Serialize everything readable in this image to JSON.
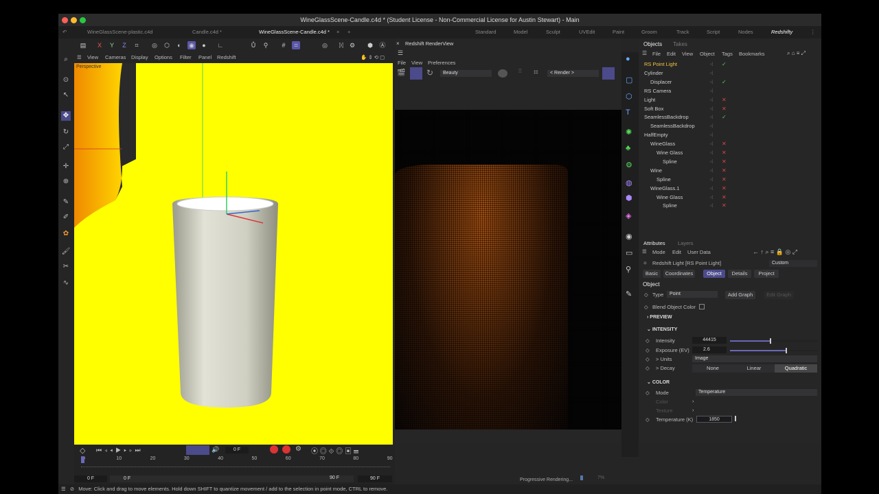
{
  "window": {
    "title": "WineGlassScene-Candle.c4d * (Student License - Non-Commercial License for Austin Stewart) - Main"
  },
  "doc_tabs": [
    "WineGlassScene-plastic.c4d",
    "Candle.c4d *",
    "WineGlassScene-Candle.c4d *"
  ],
  "workspaces": [
    "Standard",
    "Model",
    "Sculpt",
    "UVEdit",
    "Paint",
    "Groom",
    "Track",
    "Script",
    "Nodes",
    "Redshifty"
  ],
  "viewport": {
    "menu": [
      "View",
      "Cameras",
      "Display",
      "Options",
      "Filter",
      "Panel",
      "Redshift"
    ],
    "label": "Perspective",
    "axes": [
      "X",
      "Y",
      "Z"
    ]
  },
  "renderview": {
    "title": "Redshift RenderView",
    "menu": [
      "File",
      "View",
      "Preferences"
    ],
    "aov": "Beauty",
    "camera": "< Render >",
    "progress_label": "Progressive Rendering...",
    "progress_pct": "7%",
    "progress_value": 0.07
  },
  "objects": {
    "tabs": [
      "Objects",
      "Takes"
    ],
    "menu": [
      "File",
      "Edit",
      "View",
      "Object",
      "Tags",
      "Bookmarks"
    ],
    "items": [
      {
        "name": "RS Point Light",
        "indent": 0,
        "status": "check",
        "highlight": true
      },
      {
        "name": "Cylinder",
        "indent": 0,
        "status": ""
      },
      {
        "name": "Displacer",
        "indent": 1,
        "status": "check"
      },
      {
        "name": "RS Camera",
        "indent": 0,
        "status": ""
      },
      {
        "name": "Light",
        "indent": 0,
        "status": "x"
      },
      {
        "name": "Soft Box",
        "indent": 0,
        "status": "x"
      },
      {
        "name": "SeamlessBackdrop",
        "indent": 0,
        "status": "check"
      },
      {
        "name": "SeamlessBackdrop",
        "indent": 1,
        "status": ""
      },
      {
        "name": "HalfEmpty",
        "indent": 0,
        "status": ""
      },
      {
        "name": "WineGlass",
        "indent": 1,
        "status": "x"
      },
      {
        "name": "Wine Glass",
        "indent": 2,
        "status": "x"
      },
      {
        "name": "Spline",
        "indent": 3,
        "status": "x"
      },
      {
        "name": "Wine",
        "indent": 1,
        "status": "x"
      },
      {
        "name": "Spline",
        "indent": 2,
        "status": "x"
      },
      {
        "name": "WineGlass.1",
        "indent": 1,
        "status": "x"
      },
      {
        "name": "Wine Glass",
        "indent": 2,
        "status": "x"
      },
      {
        "name": "Spline",
        "indent": 3,
        "status": "x"
      }
    ]
  },
  "attributes": {
    "tabs": [
      "Attributes",
      "Layers"
    ],
    "menu": [
      "Mode",
      "Edit",
      "User Data"
    ],
    "object_title": "Redshift Light [RS Point Light]",
    "preset": "Custom",
    "subtabs": [
      "Basic",
      "Coordinates",
      "Object",
      "Details",
      "Project"
    ],
    "section": "Object",
    "type_label": "Type",
    "type_value": "Point",
    "add_graph": "Add Graph",
    "edit_graph": "Edit Graph",
    "blend_label": "Blend Object Color",
    "preview": "PREVIEW",
    "intensity_header": "INTENSITY",
    "intensity_label": "Intensity",
    "intensity_value": "44415",
    "intensity_slider": 0.45,
    "exposure_label": "Exposure (EV)",
    "exposure_value": "2.6",
    "exposure_slider": 0.63,
    "units_label": "> Units",
    "units_value": "Image",
    "decay_label": "> Decay",
    "decay_options": [
      "None",
      "Linear",
      "Quadratic"
    ],
    "color_header": "COLOR",
    "mode_label": "Mode",
    "mode_value": "Temperature",
    "color_label": "Color",
    "texture_label": "Texture",
    "temp_label": "Temperature (K)",
    "temp_value": "1850"
  },
  "timeline": {
    "current": "0 F",
    "ticks": [
      "0",
      "10",
      "20",
      "30",
      "40",
      "50",
      "60",
      "70",
      "80",
      "90"
    ],
    "start": "0 F",
    "range_start": "0 F",
    "range_end": "90 F",
    "end": "90 F"
  },
  "status": "Move: Click and drag to move elements. Hold down SHIFT to quantize movement / add to the selection in point mode, CTRL to remove."
}
